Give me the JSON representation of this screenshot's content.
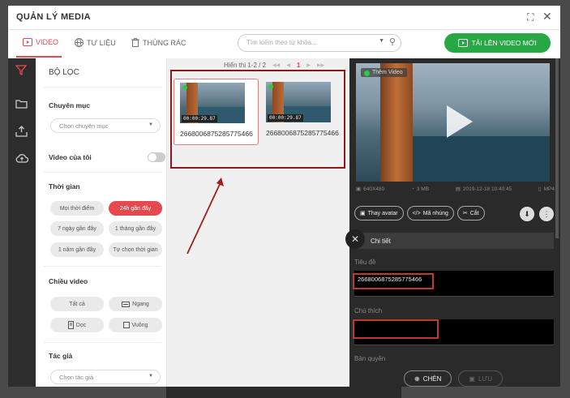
{
  "window": {
    "title": "QUẢN LÝ MEDIA",
    "expand_icon": "expand-icon",
    "close_icon": "close-icon"
  },
  "tabs": [
    {
      "label": "VIDEO",
      "icon": "video-icon",
      "active": true
    },
    {
      "label": "TƯ LIỆU",
      "icon": "globe-icon",
      "active": false
    },
    {
      "label": "THÙNG RÁC",
      "icon": "trash-icon",
      "active": false
    }
  ],
  "search": {
    "placeholder": "Tìm kiếm theo từ khóa..."
  },
  "upload_button": {
    "label": "TẢI LÊN VIDEO MỚI"
  },
  "left_rail": [
    "filter-icon",
    "folder-icon",
    "upload-stack-icon",
    "cloud-upload-icon"
  ],
  "filter": {
    "title": "BỘ LỌC",
    "category": {
      "label": "Chuyên mục",
      "placeholder": "Chọn chuyên mục"
    },
    "my_videos": {
      "label": "Video của tôi",
      "on": false
    },
    "time": {
      "label": "Thời gian",
      "options": [
        "Mọi thời điểm",
        "24h gần đây",
        "7 ngày gần đây",
        "1 tháng gần đây",
        "1 năm gần đây",
        "Tự chọn thời gian"
      ],
      "selected": "24h gần đây"
    },
    "orientation": {
      "label": "Chiều video",
      "options": [
        "Tất cả",
        "Ngang",
        "Dọc",
        "Vuông"
      ]
    },
    "author": {
      "label": "Tác giả",
      "placeholder": "Chọn tác giả"
    }
  },
  "pager": {
    "text": "Hiển thị 1-2 / 2",
    "current_page": "1"
  },
  "videos": [
    {
      "name": "2668006875285775466",
      "duration": "00:00:29.87",
      "selected": true
    },
    {
      "name": "2668006875285775466",
      "duration": "00:00:29.87",
      "selected": false
    }
  ],
  "preview": {
    "tag": "Thêm Video",
    "resolution": "640X480",
    "size": "3 MB",
    "date": "2019-12-18 10:40:45",
    "format": "MP4",
    "actions": [
      "Thay avatar",
      "Mã nhúng",
      "Cắt"
    ],
    "details_label": "Chi tiết",
    "title_label": "Tiêu đề",
    "title_value": "2668006875285775466",
    "caption_label": "Chú thích",
    "caption_value": "",
    "copyright_label": "Bản quyền",
    "insert_button": "CHÈN",
    "save_button": "LƯU"
  }
}
